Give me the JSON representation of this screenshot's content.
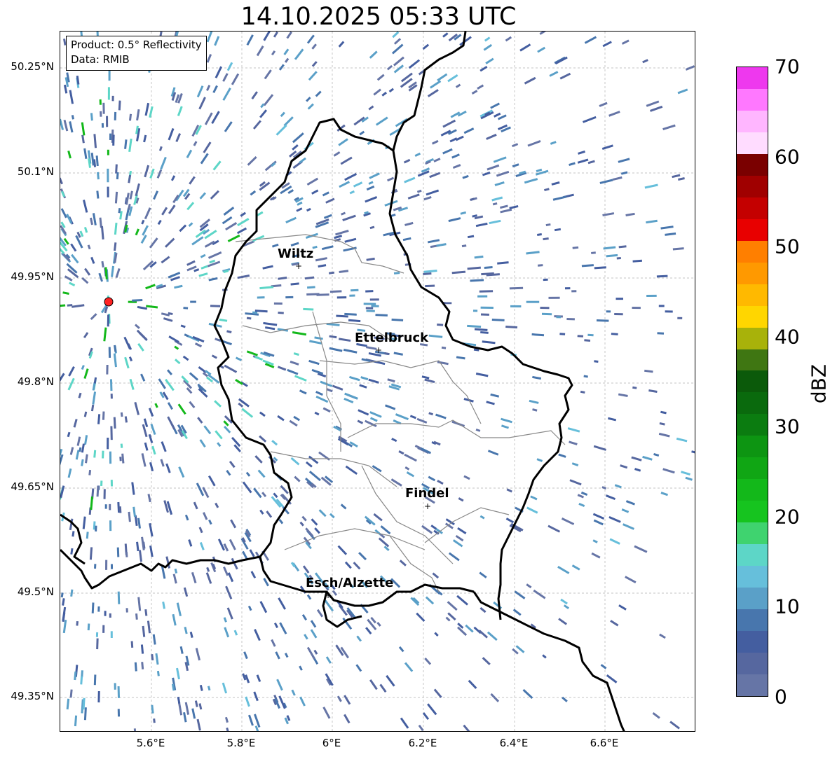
{
  "title": "14.10.2025 05:33 UTC",
  "info": {
    "product": "Product: 0.5° Reflectivity",
    "data": "Data: RMIB"
  },
  "latitude_ticks": [
    "50.25°N",
    "50.1°N",
    "49.95°N",
    "49.8°N",
    "49.65°N",
    "49.5°N",
    "49.35°N"
  ],
  "longitude_ticks": [
    "5.6°E",
    "5.8°E",
    "6°E",
    "6.2°E",
    "6.4°E",
    "6.6°E"
  ],
  "cities": [
    {
      "name": "Wiltz"
    },
    {
      "name": "Ettelbruck"
    },
    {
      "name": "Findel"
    },
    {
      "name": "Esch/Alzette"
    }
  ],
  "colorbar": {
    "label": "dBZ",
    "ticks": [
      "0",
      "10",
      "20",
      "30",
      "40",
      "50",
      "60",
      "70"
    ],
    "colors": [
      "#6675a6",
      "#56679f",
      "#445ea0",
      "#4876ad",
      "#5aa0c8",
      "#66bfdb",
      "#5dd6c7",
      "#3fd36f",
      "#16c41f",
      "#13b81a",
      "#10a614",
      "#0d9512",
      "#0b7c10",
      "#0a6a0d",
      "#0b5a0a",
      "#3f7612",
      "#a8b20a",
      "#ffd600",
      "#ffb900",
      "#ff9900",
      "#ff7f00",
      "#e80000",
      "#c40000",
      "#a00000",
      "#7a0000",
      "#ffdcff",
      "#ffb6ff",
      "#ff78ff",
      "#ee38ee"
    ]
  },
  "radar_site_color": "#ff2222"
}
